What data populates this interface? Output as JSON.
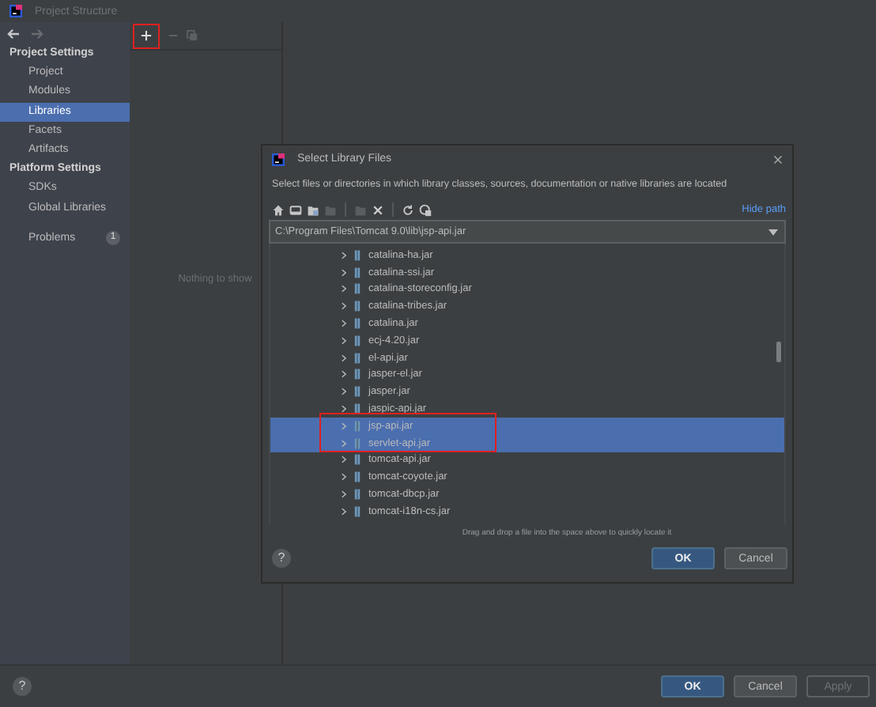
{
  "window": {
    "title": "Project Structure"
  },
  "sidebar": {
    "groups": [
      {
        "heading": "Project Settings",
        "items": [
          {
            "label": "Project",
            "selected": false
          },
          {
            "label": "Modules",
            "selected": false
          },
          {
            "label": "Libraries",
            "selected": true
          },
          {
            "label": "Facets",
            "selected": false
          },
          {
            "label": "Artifacts",
            "selected": false
          }
        ]
      },
      {
        "heading": "Platform Settings",
        "items": [
          {
            "label": "SDKs",
            "selected": false
          },
          {
            "label": "Global Libraries",
            "selected": false
          }
        ]
      }
    ],
    "problems": {
      "label": "Problems",
      "count": "1"
    }
  },
  "middle": {
    "empty_text": "Nothing to show"
  },
  "dialog": {
    "title": "Select Library Files",
    "description": "Select files or directories in which library classes, sources, documentation or native libraries are located",
    "hide_path": "Hide path",
    "path": "C:\\Program Files\\Tomcat 9.0\\lib\\jsp-api.jar",
    "files": [
      {
        "name": "catalina-ha.jar",
        "selected": false
      },
      {
        "name": "catalina-ssi.jar",
        "selected": false
      },
      {
        "name": "catalina-storeconfig.jar",
        "selected": false
      },
      {
        "name": "catalina-tribes.jar",
        "selected": false
      },
      {
        "name": "catalina.jar",
        "selected": false
      },
      {
        "name": "ecj-4.20.jar",
        "selected": false
      },
      {
        "name": "el-api.jar",
        "selected": false
      },
      {
        "name": "jasper-el.jar",
        "selected": false
      },
      {
        "name": "jasper.jar",
        "selected": false
      },
      {
        "name": "jaspic-api.jar",
        "selected": false
      },
      {
        "name": "jsp-api.jar",
        "selected": true
      },
      {
        "name": "servlet-api.jar",
        "selected": true
      },
      {
        "name": "tomcat-api.jar",
        "selected": false
      },
      {
        "name": "tomcat-coyote.jar",
        "selected": false
      },
      {
        "name": "tomcat-dbcp.jar",
        "selected": false
      },
      {
        "name": "tomcat-i18n-cs.jar",
        "selected": false
      }
    ],
    "help": "?",
    "hint": "Drag and drop a file into the space above to quickly locate it",
    "buttons": [
      {
        "label": "OK",
        "kind": "primary"
      },
      {
        "label": "Cancel",
        "kind": "secondary"
      }
    ]
  },
  "help": "?",
  "buttons": [
    {
      "label": "OK",
      "kind": "primary"
    },
    {
      "label": "Cancel",
      "kind": "secondary"
    },
    {
      "label": "Apply",
      "kind": "disabled"
    }
  ]
}
